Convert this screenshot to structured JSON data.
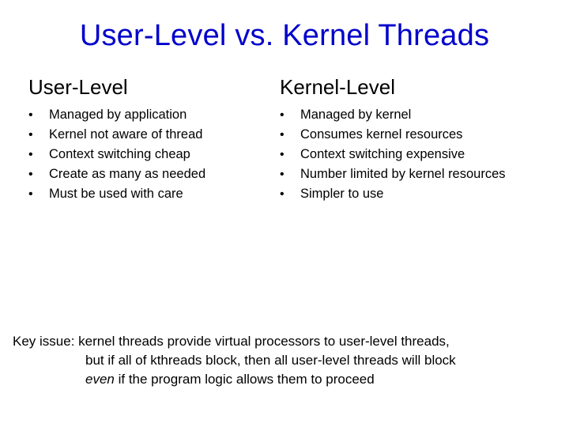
{
  "slide": {
    "title": "User-Level vs. Kernel Threads",
    "left": {
      "heading": "User-Level",
      "items": [
        "Managed by application",
        "Kernel not aware of thread",
        "Context switching cheap",
        "Create as many as needed",
        "Must be used with care"
      ]
    },
    "right": {
      "heading": "Kernel-Level",
      "items": [
        "Managed by kernel",
        "Consumes kernel resources",
        "Context switching expensive",
        "Number limited by kernel resources",
        "Simpler to use"
      ]
    },
    "keyIssue": {
      "label": "Key issue: ",
      "line1": "kernel threads provide virtual processors to user-level threads,",
      "line2": "but if all of kthreads block, then all user-level threads will block",
      "line3_pre": "even",
      "line3_post": " if the program logic allows them to proceed"
    }
  }
}
